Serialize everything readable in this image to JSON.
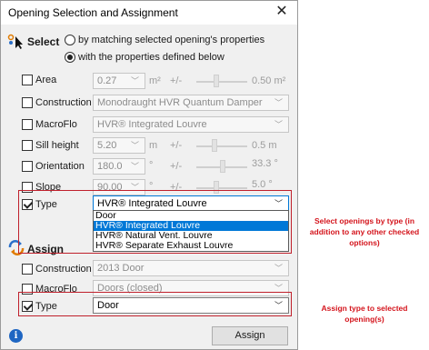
{
  "window": {
    "title": "Opening Selection and Assignment",
    "close_glyph": "✕"
  },
  "select": {
    "heading": "Select",
    "icon": "select-cursor-icon",
    "mode_options": [
      {
        "label": "by matching selected opening's properties",
        "selected": false
      },
      {
        "label": "with the properties defined below",
        "selected": true
      }
    ],
    "rows": {
      "area": {
        "label": "Area",
        "checked": false,
        "value": "0.27",
        "unit": "m²",
        "tolerance_label": "+/-",
        "tolerance_value": "0.50 m²"
      },
      "construction": {
        "label": "Construction",
        "checked": false,
        "value": "Monodraught HVR Quantum Damper"
      },
      "macroflo": {
        "label": "MacroFlo",
        "checked": false,
        "value": "HVR® Integrated Louvre"
      },
      "sill_height": {
        "label": "Sill height",
        "checked": false,
        "value": "5.20",
        "unit": "m",
        "tolerance_label": "+/-",
        "tolerance_value": "0.5 m"
      },
      "orientation": {
        "label": "Orientation",
        "checked": false,
        "value": "180.0",
        "unit": "°",
        "tolerance_label": "+/-",
        "tolerance_value": "33.3 °"
      },
      "slope": {
        "label": "Slope",
        "checked": false,
        "value": "90.00",
        "unit": "°",
        "tolerance_label": "+/-",
        "tolerance_value": "5.0 °"
      },
      "type": {
        "label": "Type",
        "checked": true,
        "value": "HVR® Integrated Louvre"
      }
    },
    "type_options": [
      {
        "label": "Door",
        "highlighted": false
      },
      {
        "label": "HVR® Integrated Louvre",
        "highlighted": true
      },
      {
        "label": "HVR® Natural Vent. Louvre",
        "highlighted": false
      },
      {
        "label": "HVR® Separate Exhaust Louvre",
        "highlighted": false
      }
    ]
  },
  "assign": {
    "heading": "Assign",
    "icon": "assign-arrows-icon",
    "rows": {
      "construction": {
        "label": "Construction",
        "checked": false,
        "value": "2013 Door"
      },
      "macroflo": {
        "label": "MacroFlo",
        "checked": false,
        "value": "Doors (closed)"
      },
      "type": {
        "label": "Type",
        "checked": true,
        "value": "Door"
      }
    },
    "button_label": "Assign"
  },
  "footer": {
    "info_icon": "info-icon",
    "info_glyph": "i"
  },
  "annotations": {
    "select_note": "Select openings by type (in addition to any other checked options)",
    "assign_note": "Assign type to selected opening(s)"
  },
  "colors": {
    "annotation_red": "#d4141c",
    "highlight_blue": "#0078d7"
  }
}
